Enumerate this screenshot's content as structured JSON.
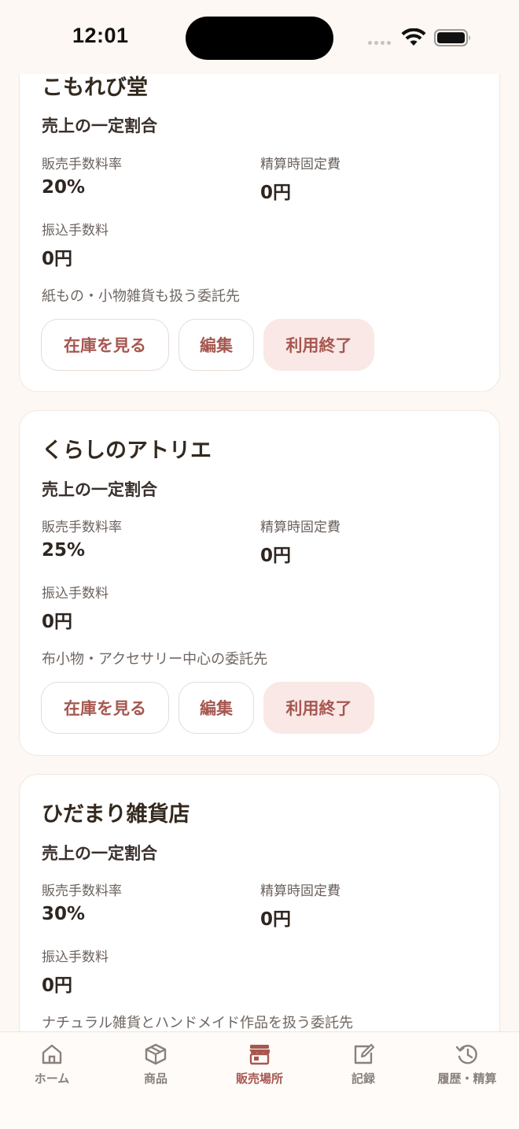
{
  "status_bar": {
    "time": "12:01"
  },
  "shops": [
    {
      "name": "こもれび堂",
      "fee_type": "売上の一定割合",
      "commission_label": "販売手数料率",
      "commission_value": "20%",
      "fixed_fee_label": "精算時固定費",
      "fixed_fee_value": "0円",
      "transfer_fee_label": "振込手数料",
      "transfer_fee_value": "0円",
      "note": "紙もの・小物雑貨も扱う委託先",
      "buttons": {
        "inventory": "在庫を見る",
        "edit": "編集",
        "end": "利用終了"
      }
    },
    {
      "name": "くらしのアトリエ",
      "fee_type": "売上の一定割合",
      "commission_label": "販売手数料率",
      "commission_value": "25%",
      "fixed_fee_label": "精算時固定費",
      "fixed_fee_value": "0円",
      "transfer_fee_label": "振込手数料",
      "transfer_fee_value": "0円",
      "note": "布小物・アクセサリー中心の委託先",
      "buttons": {
        "inventory": "在庫を見る",
        "edit": "編集",
        "end": "利用終了"
      }
    },
    {
      "name": "ひだまり雑貨店",
      "fee_type": "売上の一定割合",
      "commission_label": "販売手数料率",
      "commission_value": "30%",
      "fixed_fee_label": "精算時固定費",
      "fixed_fee_value": "0円",
      "transfer_fee_label": "振込手数料",
      "transfer_fee_value": "0円",
      "note": "ナチュラル雑貨とハンドメイド作品を扱う委託先"
    }
  ],
  "tab_bar": {
    "items": [
      {
        "label": "ホーム",
        "icon": "home-icon"
      },
      {
        "label": "商品",
        "icon": "box-icon"
      },
      {
        "label": "販売場所",
        "icon": "store-icon",
        "active": true
      },
      {
        "label": "記録",
        "icon": "edit-icon"
      },
      {
        "label": "履歴・精算",
        "icon": "history-icon"
      }
    ]
  },
  "colors": {
    "accent": "#a6574f",
    "background": "#fdf8f3",
    "end_button_bg": "#f9e8e6"
  }
}
